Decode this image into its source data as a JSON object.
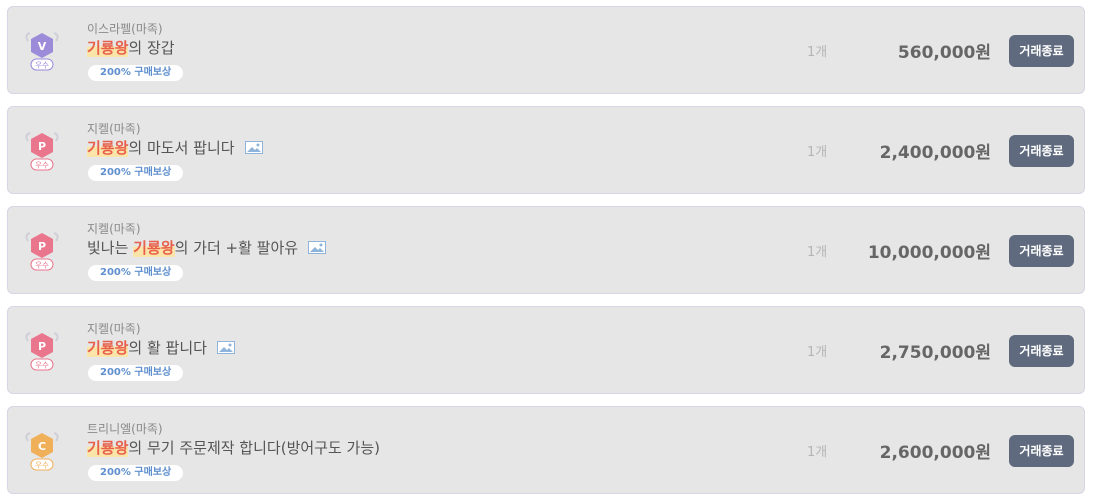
{
  "listings": [
    {
      "badge": {
        "letter": "V",
        "grade": "우수",
        "color": "#9b8bd9",
        "icon": "v-grade-icon"
      },
      "server": "이스라펠(마족)",
      "title_prefix": "",
      "keyword": "기룡왕",
      "title_suffix": "의 장갑",
      "has_image": false,
      "reward": "200% 구매보상",
      "quantity": "1개",
      "price": "560,000원",
      "button": "거래종료"
    },
    {
      "badge": {
        "letter": "P",
        "grade": "우수",
        "color": "#e9768d",
        "icon": "p-grade-icon"
      },
      "server": "지켈(마족)",
      "title_prefix": "",
      "keyword": "기룡왕",
      "title_suffix": "의 마도서 팝니다",
      "has_image": true,
      "reward": "200% 구매보상",
      "quantity": "1개",
      "price": "2,400,000원",
      "button": "거래종료"
    },
    {
      "badge": {
        "letter": "P",
        "grade": "우수",
        "color": "#e9768d",
        "icon": "p-grade-icon"
      },
      "server": "지켈(마족)",
      "title_prefix": "빛나는 ",
      "keyword": "기룡왕",
      "title_suffix": "의 가더 +활 팔아유",
      "has_image": true,
      "reward": "200% 구매보상",
      "quantity": "1개",
      "price": "10,000,000원",
      "button": "거래종료"
    },
    {
      "badge": {
        "letter": "P",
        "grade": "우수",
        "color": "#e9768d",
        "icon": "p-grade-icon"
      },
      "server": "지켈(마족)",
      "title_prefix": "",
      "keyword": "기룡왕",
      "title_suffix": "의 활 팝니다",
      "has_image": true,
      "reward": "200% 구매보상",
      "quantity": "1개",
      "price": "2,750,000원",
      "button": "거래종료"
    },
    {
      "badge": {
        "letter": "C",
        "grade": "우수",
        "color": "#f0b05a",
        "icon": "c-grade-icon"
      },
      "server": "트리니엘(마족)",
      "title_prefix": "",
      "keyword": "기룡왕",
      "title_suffix": "의 무기 주문제작 합니다(방어구도 가능)",
      "has_image": false,
      "reward": "200% 구매보상",
      "quantity": "1개",
      "price": "2,600,000원",
      "button": "거래종료"
    }
  ]
}
